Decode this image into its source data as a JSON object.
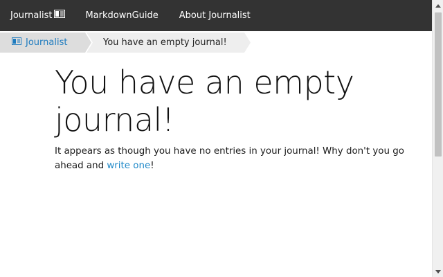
{
  "nav": {
    "brand_label": "Journalist",
    "brand_icon": "book-icon",
    "items": [
      {
        "label": "MarkdownGuide"
      },
      {
        "label": "About Journalist"
      }
    ]
  },
  "breadcrumb": {
    "home_label": "Journalist",
    "home_icon": "book-icon",
    "current_label": "You have an empty journal!"
  },
  "main": {
    "heading": "You have an empty journal!",
    "message_before": "It appears as though you have no entries in your journal! Why don't you go ahead and ",
    "link_text": "write one",
    "message_after": "!"
  },
  "colors": {
    "nav_background": "#333333",
    "link": "#1e88c8",
    "breadcrumb_home_bg": "#dddddd",
    "breadcrumb_current_bg": "#eeeeee"
  }
}
